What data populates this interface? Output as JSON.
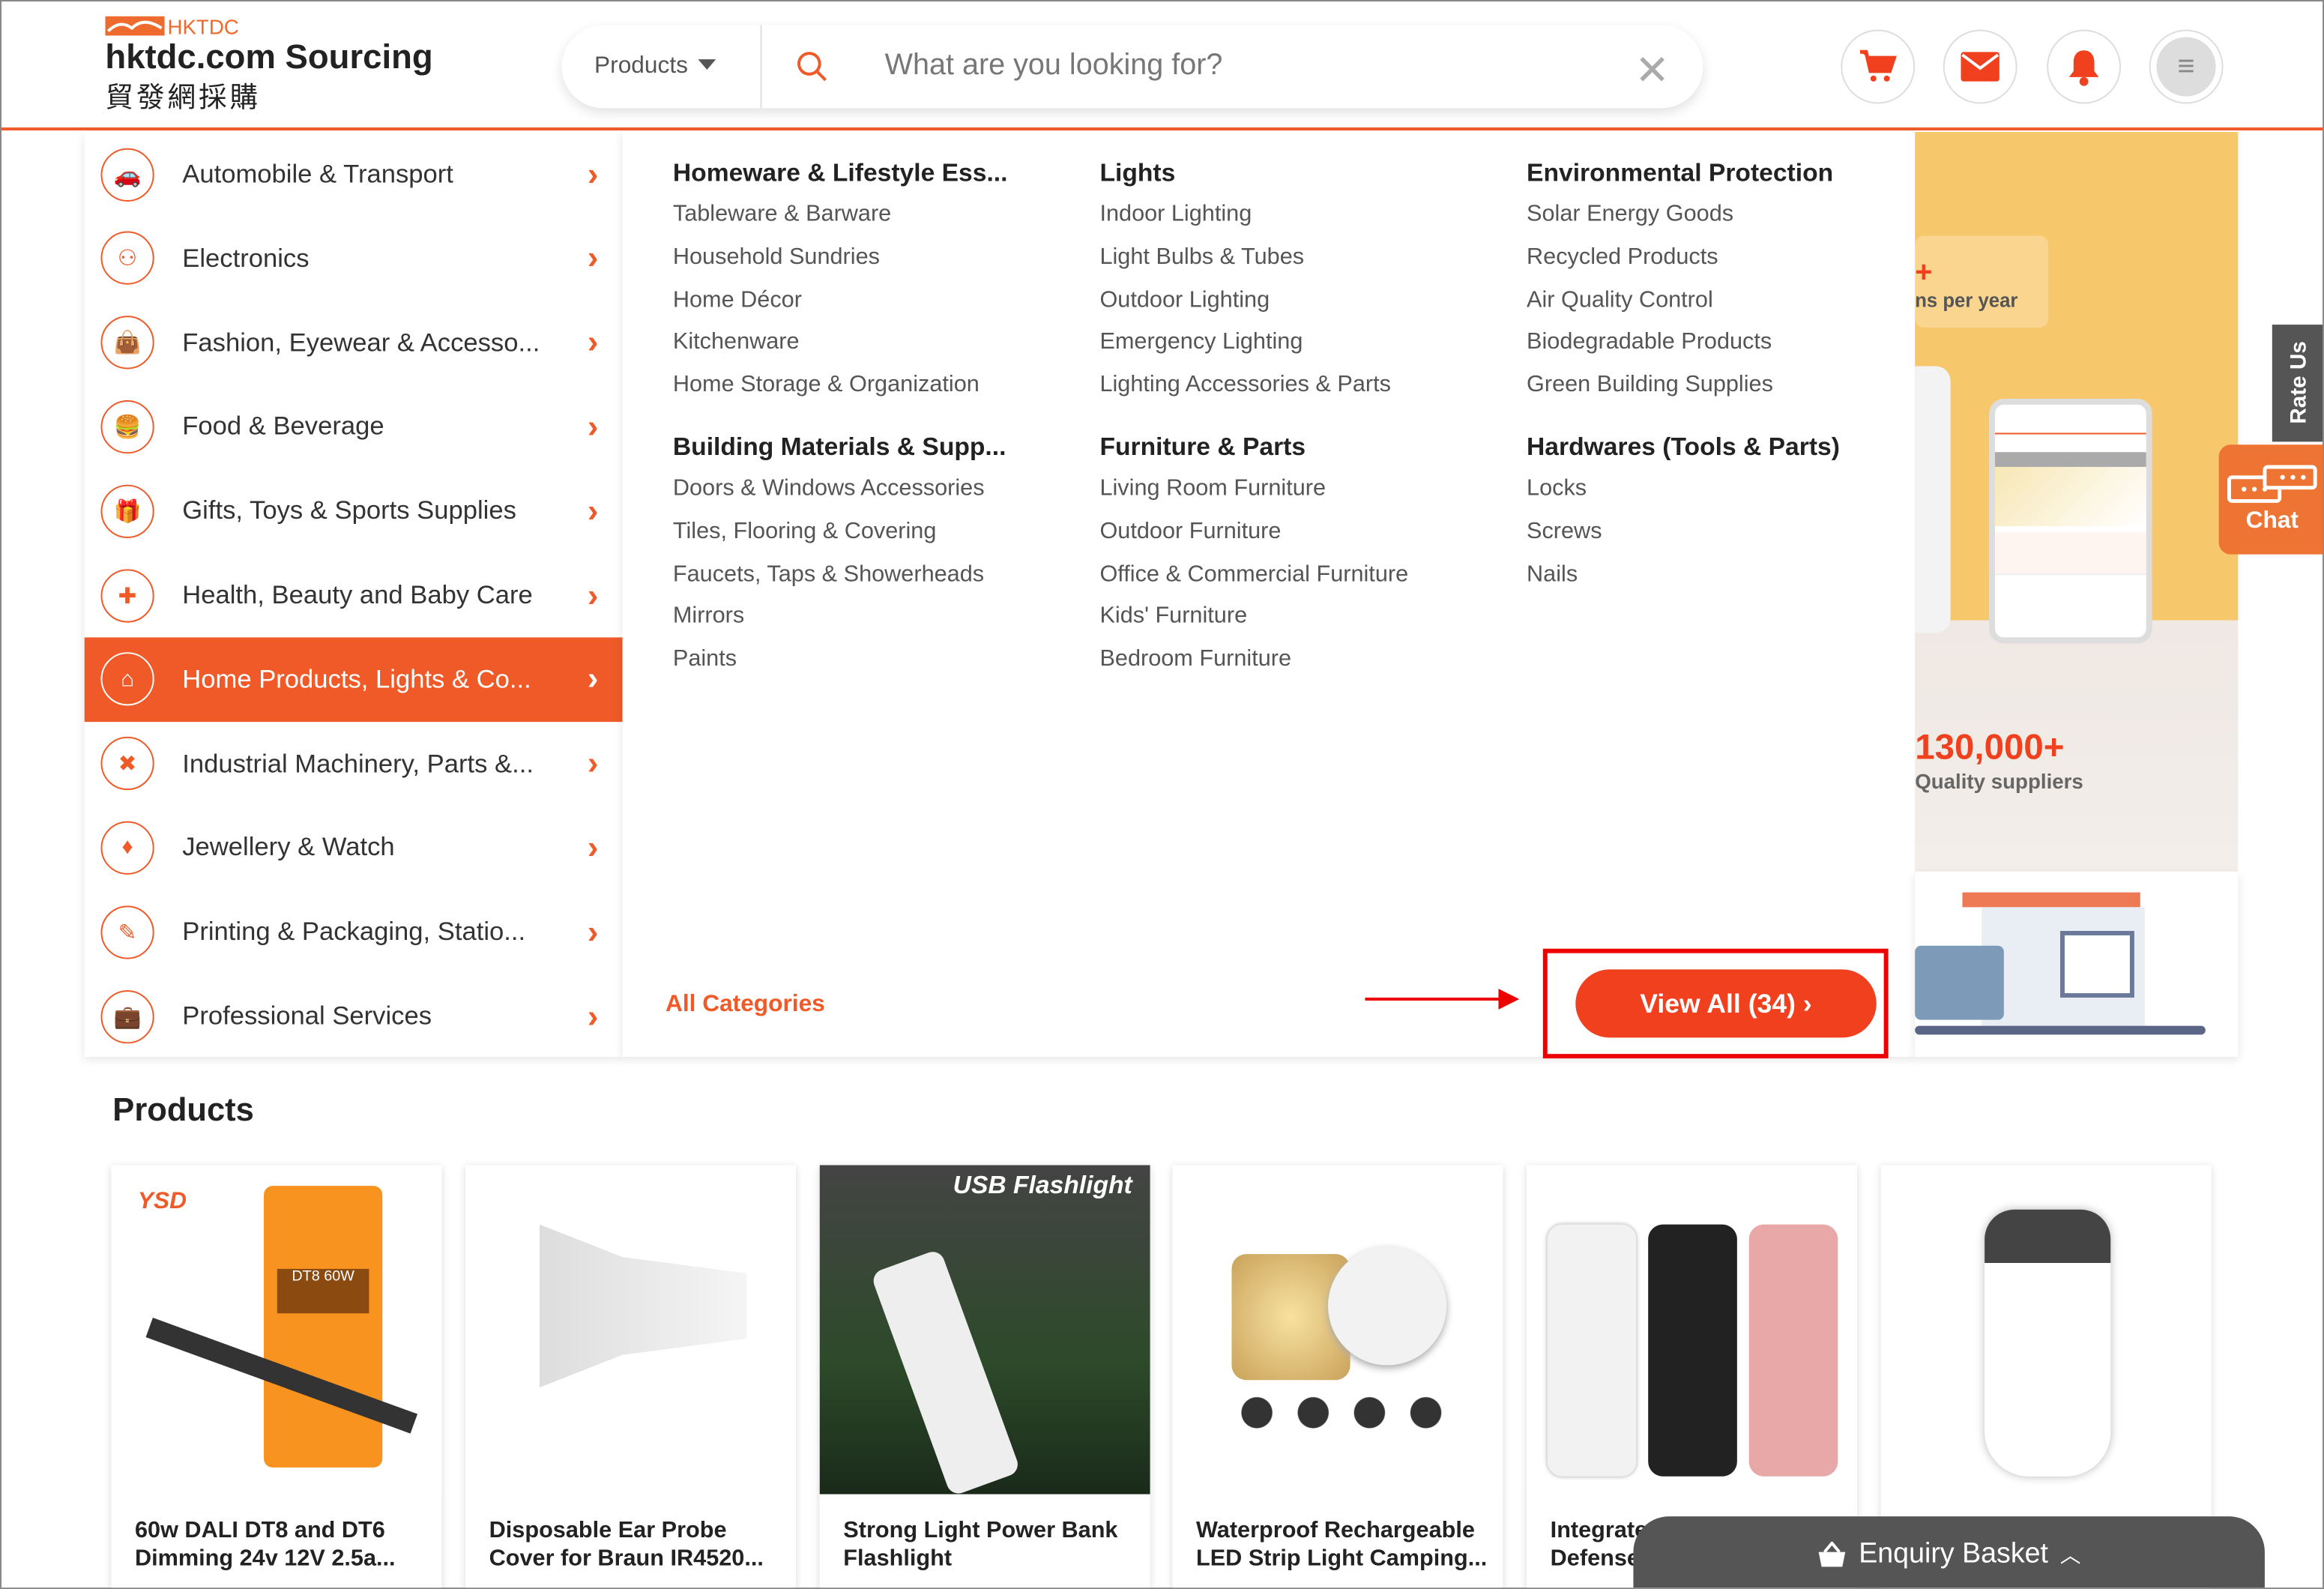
{
  "header": {
    "logo_text": "HKTDC",
    "site_title": "hktdc.com Sourcing",
    "site_title_cn": "貿發網採購",
    "search_scope": "Products",
    "search_placeholder": "What are you looking for?",
    "icons": [
      "cart-icon",
      "mail-icon",
      "bell-icon",
      "menu-icon"
    ]
  },
  "categories": [
    {
      "label": "Automobile & Transport",
      "icon": "car-icon"
    },
    {
      "label": "Electronics",
      "icon": "electronics-icon"
    },
    {
      "label": "Fashion, Eyewear & Accesso...",
      "icon": "fashion-icon"
    },
    {
      "label": "Food & Beverage",
      "icon": "burger-icon"
    },
    {
      "label": "Gifts, Toys & Sports Supplies",
      "icon": "gift-icon"
    },
    {
      "label": "Health, Beauty and Baby Care",
      "icon": "health-icon"
    },
    {
      "label": "Home Products, Lights & Co...",
      "icon": "lamp-icon",
      "active": true
    },
    {
      "label": "Industrial Machinery, Parts &...",
      "icon": "tools-icon"
    },
    {
      "label": "Jewellery & Watch",
      "icon": "diamond-icon"
    },
    {
      "label": "Printing & Packaging, Statio...",
      "icon": "pen-icon"
    },
    {
      "label": "Professional Services",
      "icon": "briefcase-icon"
    }
  ],
  "mega_menu": {
    "groups": [
      {
        "title": "Homeware & Lifestyle Ess...",
        "items": [
          "Tableware & Barware",
          "Household Sundries",
          "Home Décor",
          "Kitchenware",
          "Home Storage & Organization"
        ]
      },
      {
        "title": "Lights",
        "items": [
          "Indoor Lighting",
          "Light Bulbs & Tubes",
          "Outdoor Lighting",
          "Emergency Lighting",
          "Lighting Accessories & Parts"
        ]
      },
      {
        "title": "Environmental Protection",
        "items": [
          "Solar Energy Goods",
          "Recycled Products",
          "Air Quality Control",
          "Biodegradable Products",
          "Green Building Supplies"
        ]
      },
      {
        "title": "Building Materials & Supp...",
        "items": [
          "Doors & Windows Accessories",
          "Tiles, Flooring & Covering",
          "Faucets, Taps & Showerheads",
          "Mirrors",
          "Paints"
        ]
      },
      {
        "title": "Furniture & Parts",
        "items": [
          "Living Room Furniture",
          "Outdoor Furniture",
          "Office & Commercial Furniture",
          "Kids' Furniture",
          "Bedroom Furniture"
        ]
      },
      {
        "title": "Hardwares (Tools & Parts)",
        "items": [
          "Locks",
          "Screws",
          "Nails"
        ]
      }
    ],
    "all_categories": "All Categories",
    "view_all": "View All (34) ›"
  },
  "banner": {
    "stat1_number": "+",
    "stat1_text": "ns per year",
    "stat2_number": "130,000+",
    "stat2_text": "Quality suppliers"
  },
  "side": {
    "rate_us": "Rate Us",
    "chat": "Chat"
  },
  "products": {
    "title": "Products",
    "items": [
      {
        "name": "60w DALI DT8 and DT6 Dimming 24v 12V 2.5a...",
        "image_text": "DT8 60W"
      },
      {
        "name": "Disposable Ear Probe Cover for Braun IR4520..."
      },
      {
        "name": "Strong Light Power Bank Flashlight",
        "image_text": "USB Flashlight"
      },
      {
        "name": "Waterproof Rechargeable LED Strip Light Camping..."
      },
      {
        "name": "Integrated Personal Defense..."
      },
      {
        "name": ""
      }
    ]
  },
  "enquiry_basket": "Enquiry Basket",
  "colors": {
    "accent": "#f05a28",
    "button": "#f0401e",
    "banner": "#f7c76b",
    "annotation": "#ee0000"
  }
}
